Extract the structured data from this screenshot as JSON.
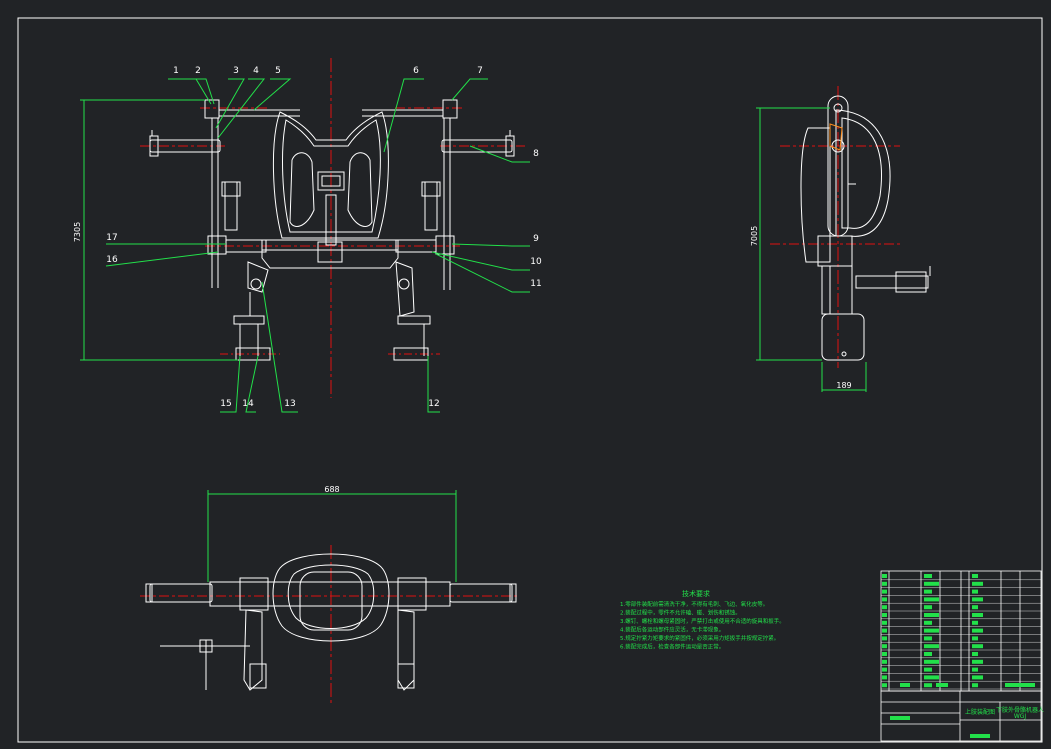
{
  "drawing": {
    "background": "#212326",
    "colors": {
      "outline": "#ffffff",
      "centerline": "#e01010",
      "dimension": "#22e04a",
      "leader": "#22e04a"
    },
    "part_numbers_front": [
      "1",
      "2",
      "3",
      "4",
      "5",
      "6",
      "7",
      "8",
      "9",
      "10",
      "11",
      "12",
      "13",
      "14",
      "15",
      "16",
      "17"
    ],
    "dimensions": {
      "front_height": "7305",
      "side_height": "7005",
      "side_width": "189",
      "top_width": "688"
    },
    "tech_requirements": {
      "title": "技术要求",
      "lines": [
        "1.零部件装配前需清洗干净，不得有毛刺、飞边、氧化皮等。",
        "2.装配过程中，零件不允许磕、碰、划伤和锈蚀。",
        "3.螺钉、螺栓和螺母紧固时，严禁打击或使用不合适的旋具和扳手。",
        "4.装配后各运动部件应灵活，无卡滞现象。",
        "5.规定拧紧力矩要求的紧固件，必须采用力矩扳手并按规定拧紧。",
        "6.装配完成后，检查各部件运动是否正常。"
      ]
    },
    "title_block": {
      "drawing_name": "上肢装配图",
      "project": "下肢外骨骼机器人",
      "code": "WGJ"
    }
  }
}
